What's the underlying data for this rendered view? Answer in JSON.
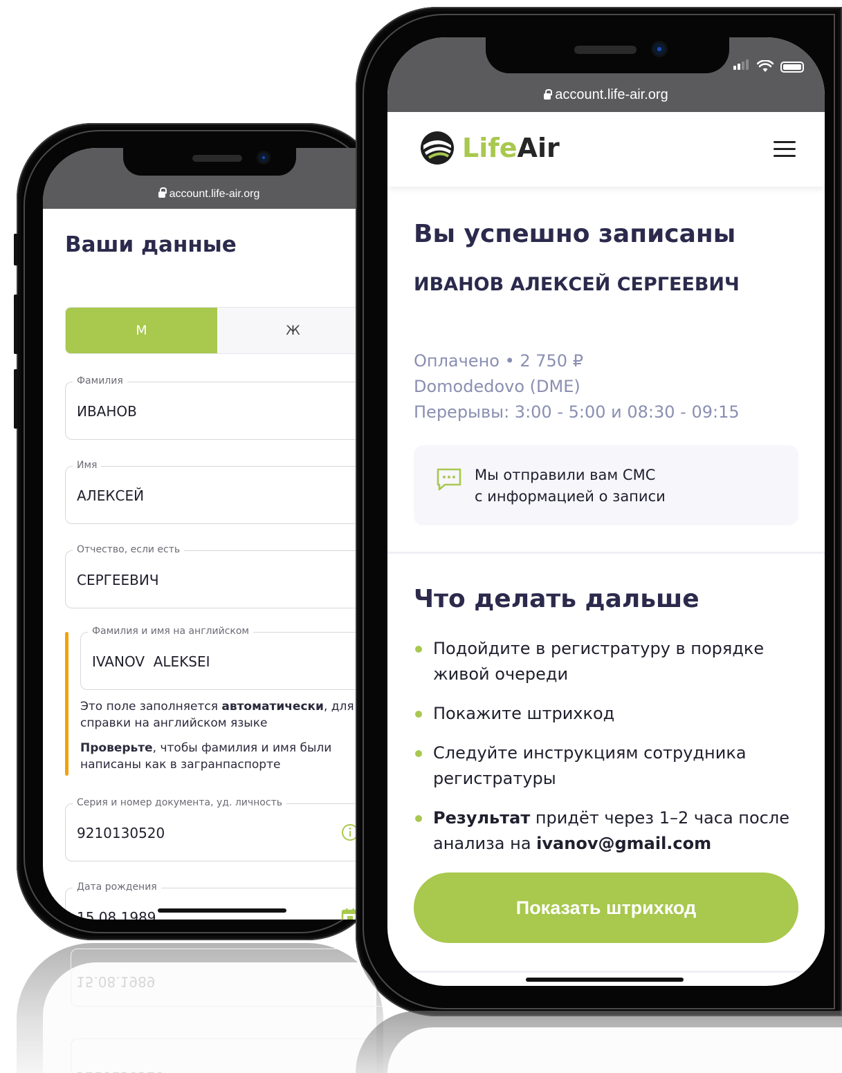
{
  "browser": {
    "url": "account.life-air.org"
  },
  "left_screen": {
    "title": "Ваши данные",
    "gender": {
      "male": "М",
      "female": "Ж",
      "selected": "М"
    },
    "fields": {
      "last_name": {
        "label": "Фамилия",
        "value": "ИВАНОВ"
      },
      "first_name": {
        "label": "Имя",
        "value": "АЛЕКСЕЙ"
      },
      "middle_name": {
        "label": "Отчество, если есть",
        "value": "СЕРГЕЕВИЧ"
      },
      "english_name": {
        "label": "Фамилия и имя на английском",
        "value": "IVANOV  ALEKSEI"
      },
      "document": {
        "label": "Серия и номер документа, уд. личность",
        "value": "9210130520"
      },
      "birth_date": {
        "label": "Дата рождения",
        "value": "15.08.1989"
      }
    },
    "note1": {
      "before": "Это поле заполняется ",
      "bold": "автоматически",
      "after": ", для справки на английском языке"
    },
    "note2": {
      "bold": "Проверьте",
      "after": ", чтобы фамилия и имя были написаны как в загранпаспорте"
    }
  },
  "right_screen": {
    "logo": {
      "part1": "Life",
      "part2": "Air"
    },
    "title": "Вы успешно записаны",
    "patient_name": "ИВАНОВ АЛЕКСЕЙ СЕРГЕЕВИЧ",
    "paid": "Оплачено  • 2 750 ₽",
    "location": "Domodedovo (DME)",
    "breaks": "Перерывы: 3:00 - 5:00 и 08:30 - 09:15",
    "sms_line1": "Мы отправили вам СМС",
    "sms_line2": "с информацией о записи",
    "next_title": "Что делать дальше",
    "steps": {
      "s1": "Подойдите в регистратуру в порядке живой очереди",
      "s2": "Покажите штрихкод",
      "s3": "Следуйте инструкциям сотрудника регистратуры",
      "s4_bold": "Результат",
      "s4_mid": " придёт через 1–2 часа после анализа на ",
      "s4_email": "ivanov@gmail.com"
    },
    "cta": "Показать штрихкод"
  },
  "colors": {
    "accent": "#a8c84e",
    "warning": "#f2a20d",
    "heading": "#2b2a4c",
    "muted": "#8a8fb2"
  },
  "icons": [
    "lock-icon",
    "logo-icon",
    "menu-icon",
    "sms-icon",
    "info-icon",
    "calendar-icon",
    "signal-icon",
    "wifi-icon",
    "battery-icon"
  ]
}
